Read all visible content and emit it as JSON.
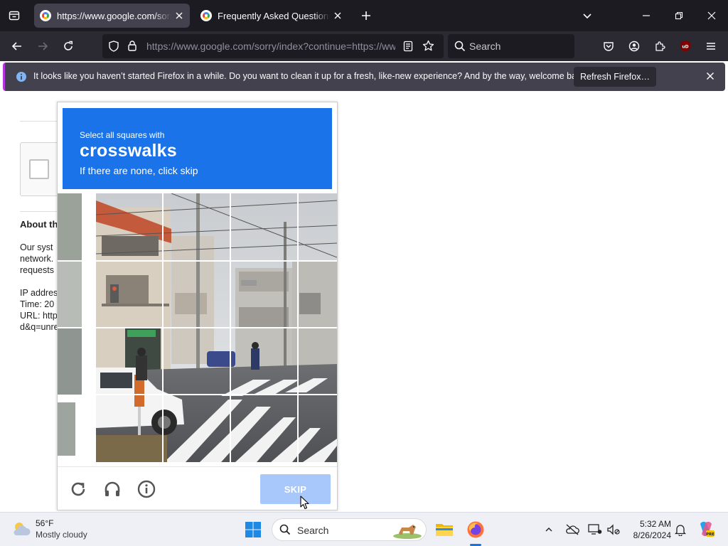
{
  "browser": {
    "tabs": [
      {
        "title": "https://www.google.com/sorry/index?continue=https://www.google.com/search",
        "active": true
      },
      {
        "title": "Frequently Asked Questions | noVNC",
        "active": false
      }
    ],
    "url": "https://www.google.com/sorry/index?continue=https://www.google.com/search",
    "search_placeholder": "Search"
  },
  "notification": {
    "message": "It looks like you haven’t started Firefox in a while. Do you want to clean it up for a fresh, like-new experience? And by the way, welcome back!",
    "button": "Refresh Firefox…"
  },
  "background_page": {
    "about_heading": "About th",
    "lines": [
      "Our syst",
      "network.",
      "requests"
    ],
    "ip_label": "IP addres",
    "time_label": "Time: 20",
    "url_label": "URL: http",
    "url_tail": "d&q=unre"
  },
  "captcha": {
    "instruction_line1": "Select all squares with",
    "target": "crosswalks",
    "instruction_line3": "If there are none, click skip",
    "skip_label": "SKIP",
    "header_color": "#1a73e8",
    "icons": [
      "reload-icon",
      "headphones-icon",
      "info-icon"
    ]
  },
  "taskbar": {
    "weather_temp": "56°F",
    "weather_desc": "Mostly cloudy",
    "search_placeholder": "Search",
    "time": "5:32 AM",
    "date": "8/26/2024"
  }
}
